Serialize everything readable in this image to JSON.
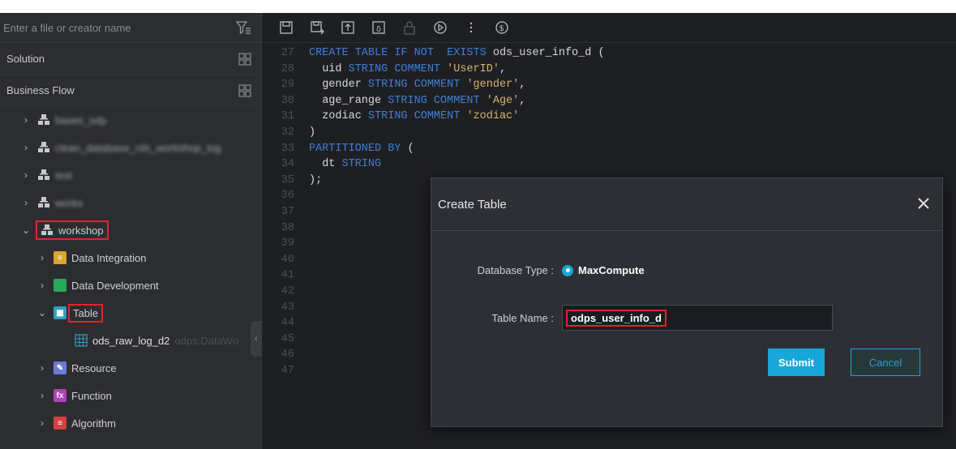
{
  "sidebar": {
    "search_placeholder": "Enter a file or creator name",
    "sections": [
      {
        "label": "Solution"
      },
      {
        "label": "Business Flow"
      }
    ],
    "flows": [
      {
        "label": "bases_odp"
      },
      {
        "label": "clean_database_rds_workshop_log"
      },
      {
        "label": "test"
      },
      {
        "label": "works"
      }
    ],
    "workshop": {
      "label": "workshop",
      "children": [
        {
          "label": "Data Integration",
          "color": "#d9a62e",
          "glyph": "≡"
        },
        {
          "label": "Data Development",
          "color": "#2aa85a",
          "glyph": "</>"
        },
        {
          "label": "Table",
          "color": "#2fa0c0",
          "glyph": "▦"
        },
        {
          "label": "Resource",
          "color": "#6b7cd8",
          "glyph": "✎"
        },
        {
          "label": "Function",
          "color": "#b040b8",
          "glyph": "fx"
        },
        {
          "label": "Algorithm",
          "color": "#d84040",
          "glyph": "≡"
        }
      ],
      "table_item": {
        "name": "ods_raw_log_d2",
        "owner": "odps.DataWo"
      }
    }
  },
  "editor": {
    "lines": [
      {
        "n": "27",
        "parts": [
          [
            "kw",
            "CREATE TABLE IF NOT  EXISTS "
          ],
          [
            "plain",
            "ods_user_info_d ("
          ]
        ]
      },
      {
        "n": "28",
        "parts": [
          [
            "plain",
            "  uid "
          ],
          [
            "kw",
            "STRING COMMENT "
          ],
          [
            "str",
            "'UserID'"
          ],
          [
            "plain",
            ","
          ]
        ]
      },
      {
        "n": "29",
        "parts": [
          [
            "plain",
            "  gender "
          ],
          [
            "kw",
            "STRING COMMENT "
          ],
          [
            "str",
            "'gender'"
          ],
          [
            "plain",
            ","
          ]
        ]
      },
      {
        "n": "30",
        "parts": [
          [
            "plain",
            "  age_range "
          ],
          [
            "kw",
            "STRING COMMENT "
          ],
          [
            "str",
            "'Age'"
          ],
          [
            "plain",
            ","
          ]
        ]
      },
      {
        "n": "31",
        "parts": [
          [
            "plain",
            "  zodiac "
          ],
          [
            "kw",
            "STRING COMMENT "
          ],
          [
            "str",
            "'zodiac'"
          ]
        ]
      },
      {
        "n": "32",
        "parts": [
          [
            "plain",
            ")"
          ]
        ]
      },
      {
        "n": "33",
        "parts": [
          [
            "kw",
            "PARTITIONED BY "
          ],
          [
            "plain",
            "("
          ]
        ]
      },
      {
        "n": "34",
        "parts": [
          [
            "plain",
            "  dt "
          ],
          [
            "kw",
            "STRING"
          ]
        ]
      },
      {
        "n": "35",
        "parts": [
          [
            "plain",
            ");"
          ]
        ]
      },
      {
        "n": "36",
        "parts": []
      },
      {
        "n": "37",
        "parts": []
      },
      {
        "n": "38",
        "parts": []
      },
      {
        "n": "39",
        "parts": []
      },
      {
        "n": "40",
        "parts": []
      },
      {
        "n": "41",
        "parts": []
      },
      {
        "n": "42",
        "parts": []
      },
      {
        "n": "43",
        "parts": []
      },
      {
        "n": "44",
        "parts": []
      },
      {
        "n": "45",
        "parts": []
      },
      {
        "n": "46",
        "parts": []
      },
      {
        "n": "47",
        "parts": []
      }
    ]
  },
  "modal": {
    "title": "Create Table",
    "db_type_label": "Database Type :",
    "db_type_value": "MaxCompute",
    "table_name_label": "Table Name :",
    "table_name_value": "odps_user_info_d",
    "submit_label": "Submit",
    "cancel_label": "Cancel"
  },
  "colors": {
    "accent": "#17a7d8",
    "highlight": "#e3232b"
  }
}
